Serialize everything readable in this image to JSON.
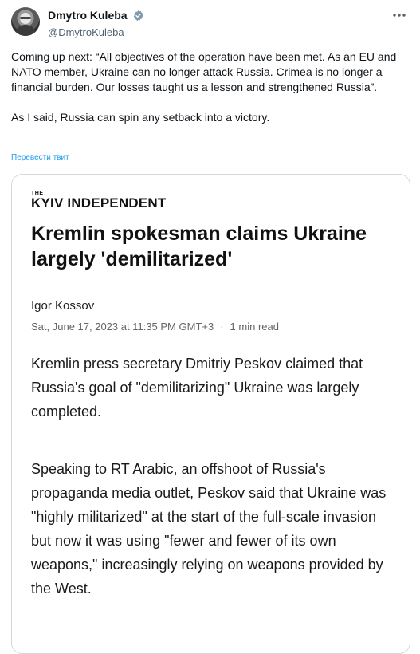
{
  "tweet": {
    "author_name": "Dmytro Kuleba",
    "handle": "@DmytroKuleba",
    "text_1": "Coming up next: “All objectives of the operation have been met. As an EU and NATO member, Ukraine can no longer attack Russia. Crimea is no longer a financial burden. Our losses taught us a lesson and strengthened Russia”.",
    "text_2": "As I said, Russia can spin any setback into a victory.",
    "translate_link": "Перевести твит"
  },
  "article": {
    "brand_the": "THE",
    "brand_name": "KYIV INDEPENDENT",
    "headline": "Kremlin spokesman claims Ukraine largely 'demilitarized'",
    "author": "Igor Kossov",
    "date": "Sat, June 17, 2023 at 11:35 PM GMT+3",
    "read_time": "1 min read",
    "paragraph_1": "Kremlin press secretary Dmitriy Peskov claimed that Russia's goal of \"demilitarizing\" Ukraine was largely completed.",
    "paragraph_2": "Speaking to RT Arabic, an offshoot of Russia's propaganda media outlet, Peskov said that Ukraine was \"highly militarized\" at the start of the full-scale invasion but now it was using \"fewer and fewer of its own weapons,\" increasingly relying on weapons provided by the West."
  },
  "icons": {
    "verified": "verified-badge-icon",
    "more": "more-options-icon"
  },
  "colors": {
    "link": "#1d9bf0",
    "secondary_text": "#536471",
    "verified_badge": "#829aab"
  }
}
